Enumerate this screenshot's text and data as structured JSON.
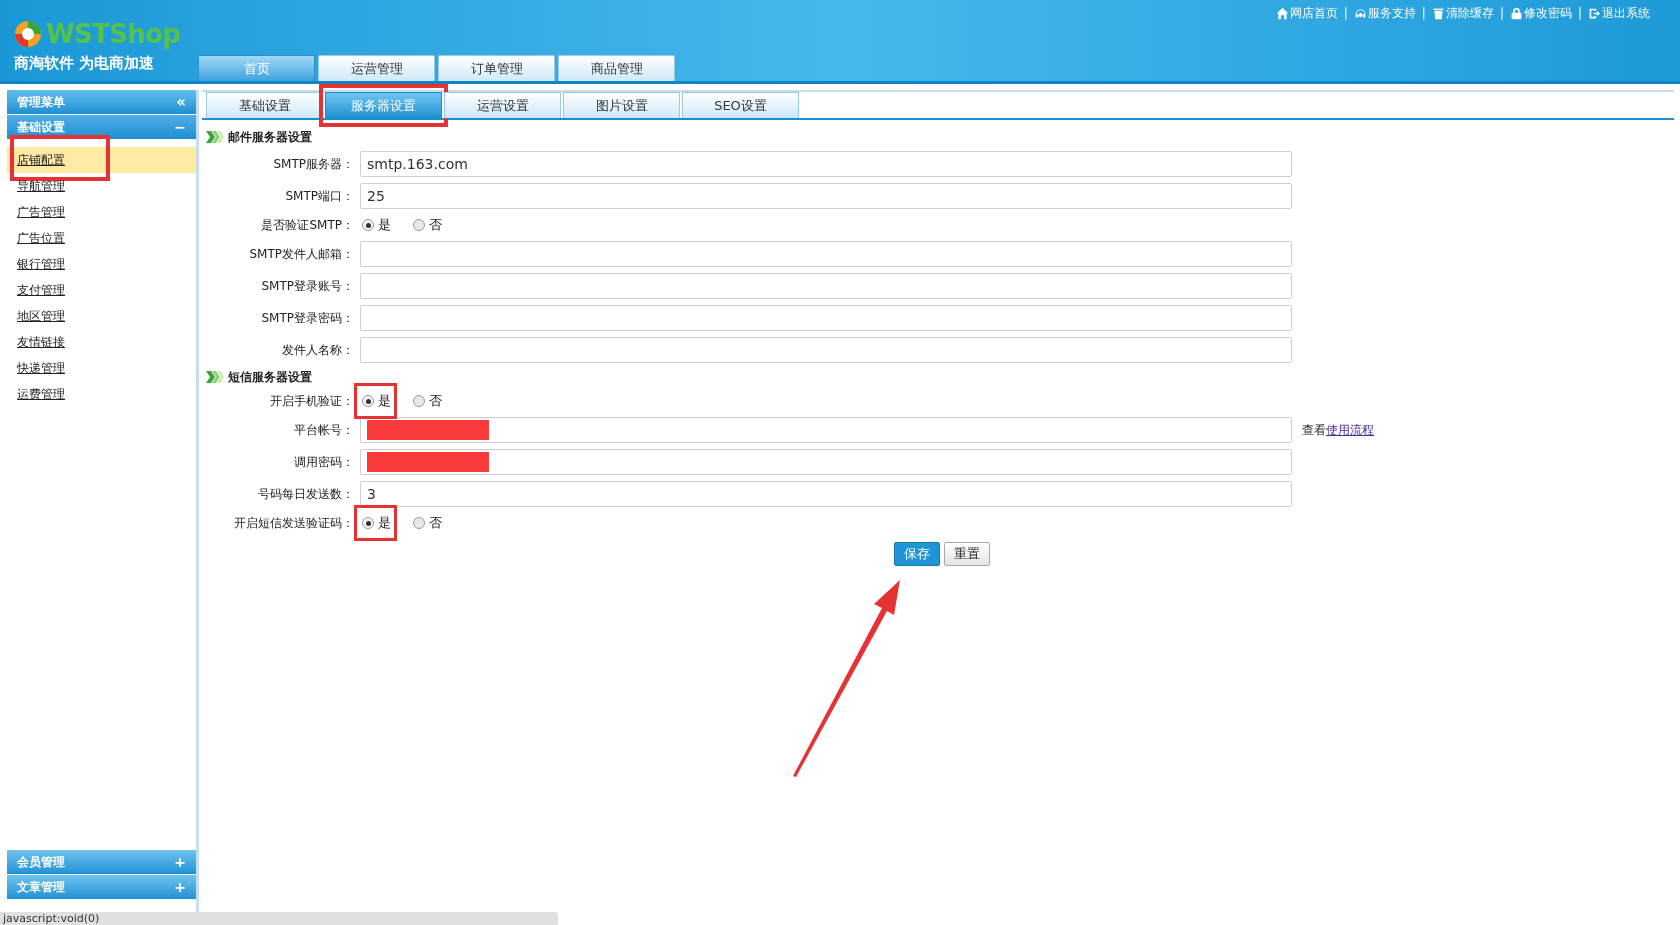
{
  "header": {
    "logo": {
      "brand": "WSTShop",
      "slogan": "商淘软件 为电商加速"
    },
    "top_links": [
      {
        "kind": "home",
        "label": "网店首页",
        "separator": "|"
      },
      {
        "kind": "support",
        "label": "服务支持",
        "separator": "|"
      },
      {
        "kind": "trash",
        "label": "清除缓存",
        "separator": "|"
      },
      {
        "kind": "lock",
        "label": "修改密码",
        "separator": "|"
      },
      {
        "kind": "logout",
        "label": "退出系统"
      }
    ],
    "nav_tabs": [
      {
        "label": "首页",
        "selected": true
      },
      {
        "label": "运营管理",
        "selected": false
      },
      {
        "label": "订单管理",
        "selected": false
      },
      {
        "label": "商品管理",
        "selected": false
      }
    ]
  },
  "sidebar": {
    "title": "管理菜单",
    "collapse_glyph": "«",
    "groups": [
      {
        "label": "基础设置",
        "glyph": "−",
        "expanded": true,
        "items": [
          {
            "label": "店铺配置",
            "selected": true,
            "highlighted": true
          },
          {
            "label": "导航管理",
            "selected": false,
            "highlighted": false
          },
          {
            "label": "广告管理",
            "selected": false,
            "highlighted": false
          },
          {
            "label": "广告位置",
            "selected": false,
            "highlighted": false
          },
          {
            "label": "银行管理",
            "selected": false,
            "highlighted": false
          },
          {
            "label": "支付管理",
            "selected": false,
            "highlighted": false
          },
          {
            "label": "地区管理",
            "selected": false,
            "highlighted": false
          },
          {
            "label": "友情链接",
            "selected": false,
            "highlighted": false
          },
          {
            "label": "快递管理",
            "selected": false,
            "highlighted": false
          },
          {
            "label": "运费管理",
            "selected": false,
            "highlighted": false
          }
        ]
      },
      {
        "label": "会员管理",
        "glyph": "+",
        "expanded": false
      },
      {
        "label": "文章管理",
        "glyph": "+",
        "expanded": false
      }
    ]
  },
  "sub_tabs": [
    {
      "label": "基础设置",
      "selected": false,
      "highlighted": false
    },
    {
      "label": "服务器设置",
      "selected": true,
      "highlighted": true
    },
    {
      "label": "运营设置",
      "selected": false,
      "highlighted": false
    },
    {
      "label": "图片设置",
      "selected": false,
      "highlighted": false
    },
    {
      "label": "SEO设置",
      "selected": false,
      "highlighted": false
    }
  ],
  "sections": [
    {
      "title": "邮件服务器设置",
      "fields": [
        {
          "kind": "text",
          "label": "SMTP服务器：",
          "value": "smtp.163.com"
        },
        {
          "kind": "text",
          "label": "SMTP端口：",
          "value": "25"
        },
        {
          "kind": "radio",
          "label": "是否验证SMTP：",
          "options": [
            {
              "label": "是",
              "selected": true
            },
            {
              "label": "否",
              "selected": false
            }
          ]
        },
        {
          "kind": "text",
          "label": "SMTP发件人邮箱："
        },
        {
          "kind": "text",
          "label": "SMTP登录账号："
        },
        {
          "kind": "text",
          "label": "SMTP登录密码："
        },
        {
          "kind": "text",
          "label": "发件人名称："
        }
      ]
    },
    {
      "title": "短信服务器设置",
      "fields": [
        {
          "kind": "radio",
          "label": "开启手机验证：",
          "highlighted": true,
          "options": [
            {
              "label": "是",
              "selected": true
            },
            {
              "label": "否",
              "selected": false
            }
          ]
        },
        {
          "kind": "text",
          "label": "平台帐号：",
          "redacted": true,
          "note": {
            "prefix": "查看",
            "link": "使用流程"
          }
        },
        {
          "kind": "text",
          "label": "调用密码：",
          "redacted": true
        },
        {
          "kind": "text",
          "label": "号码每日发送数：",
          "value": "3"
        },
        {
          "kind": "radio",
          "label": "开启短信发送验证码：",
          "highlighted": true,
          "options": [
            {
              "label": "是",
              "selected": true
            },
            {
              "label": "否",
              "selected": false
            }
          ]
        }
      ]
    }
  ],
  "buttons": [
    {
      "kind": "primary",
      "label": "保存"
    },
    {
      "kind": "default",
      "label": "重置"
    }
  ],
  "status_bar": "javascript:void(0)"
}
